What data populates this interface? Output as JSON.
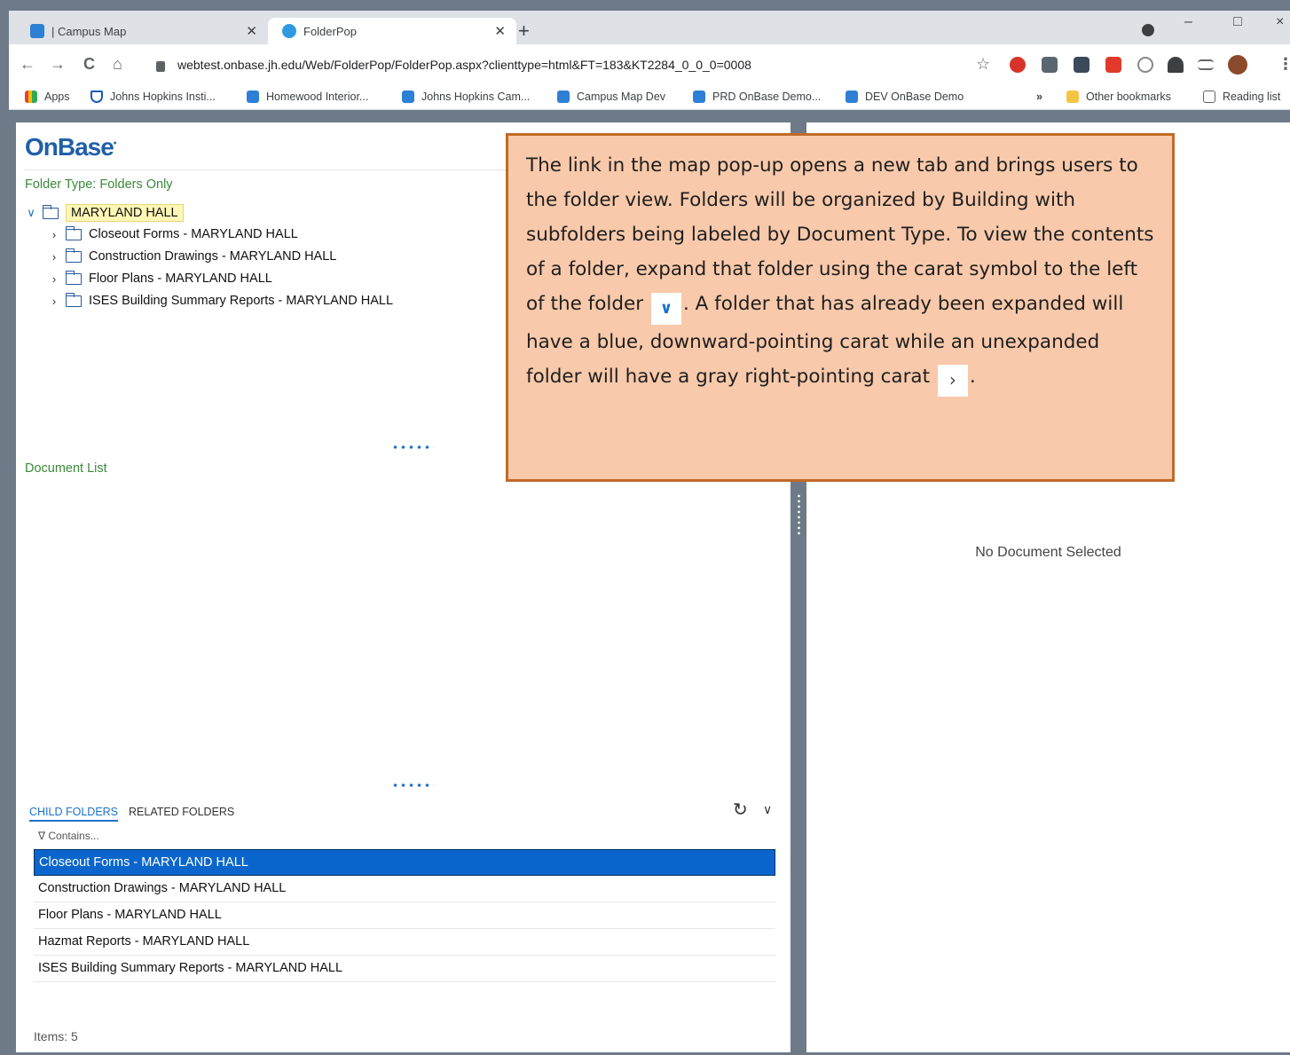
{
  "browser": {
    "tabs": [
      {
        "title": "| Campus Map",
        "active": false
      },
      {
        "title": "FolderPop",
        "active": true
      }
    ],
    "new_tab": "+",
    "window_controls": {
      "minimize": "–",
      "maximize": "□",
      "close": "×"
    },
    "nav": {
      "back": "←",
      "forward": "→",
      "reload": "C",
      "home": "⌂"
    },
    "url": "webtest.onbase.jh.edu/Web/FolderPop/FolderPop.aspx?clienttype=html&FT=183&KT2284_0_0_0=0008",
    "bookmarks": [
      "Apps",
      "Johns Hopkins Insti...",
      "Homewood Interior...",
      "Johns Hopkins Cam...",
      "Campus Map Dev",
      "PRD OnBase Demo...",
      "DEV OnBase Demo"
    ],
    "more_bookmarks": "»",
    "other_bookmarks": "Other bookmarks",
    "reading_list": "Reading list"
  },
  "app": {
    "logo": "OnBase",
    "folder_type": "Folder Type: Folders Only",
    "tree": {
      "root": "MARYLAND HALL",
      "children": [
        "Closeout Forms - MARYLAND HALL",
        "Construction Drawings - MARYLAND HALL",
        "Floor Plans - MARYLAND HALL",
        "ISES Building Summary Reports - MARYLAND HALL"
      ]
    },
    "document_list_label": "Document List",
    "child_tabs": [
      "CHILD FOLDERS",
      "RELATED FOLDERS"
    ],
    "filter_placeholder": "∇ Contains...",
    "child_folders": [
      "Closeout Forms - MARYLAND HALL",
      "Construction Drawings - MARYLAND HALL",
      "Floor Plans - MARYLAND HALL",
      "Hazmat Reports - MARYLAND HALL",
      "ISES Building Summary Reports - MARYLAND HALL"
    ],
    "items_count": "Items: 5",
    "no_document": "No Document Selected"
  },
  "callout": {
    "line1": "The link in the map pop-up opens a new tab and brings users to the folder view. Folders will be organized by Building with subfolders being labeled by Document Type. To view the contents of a folder, expand that folder using the carat symbol to the left of the folder",
    "line2": ". A folder that has already been expanded will have a blue, downward-pointing carat while an unexpanded folder will have a gray right-pointing carat",
    "line3": "."
  },
  "colors": {
    "accent": "#1a73c8",
    "selected_row": "#0a66cc",
    "callout_bg": "#f8c9aa",
    "callout_border": "#c06a28",
    "green_label": "#3a8a3a"
  }
}
